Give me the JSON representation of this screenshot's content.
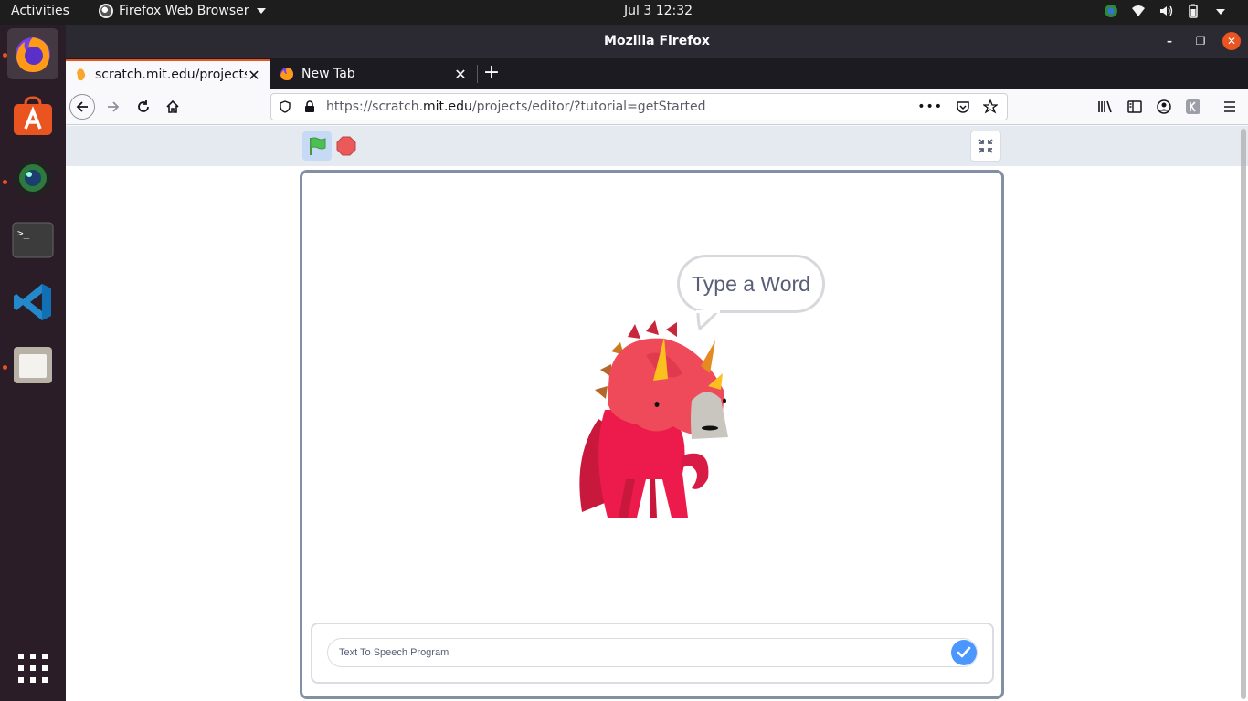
{
  "topbar": {
    "activities": "Activities",
    "app_menu": "Firefox Web Browser",
    "clock": "Jul 3  12:32"
  },
  "dock": {
    "items": [
      {
        "name": "Firefox",
        "icon": "firefox-icon"
      },
      {
        "name": "Ubuntu Software",
        "icon": "software-icon"
      },
      {
        "name": "Camera",
        "icon": "camera-icon"
      },
      {
        "name": "Terminal",
        "icon": "terminal-icon"
      },
      {
        "name": "Visual Studio Code",
        "icon": "vscode-icon"
      },
      {
        "name": "Files",
        "icon": "files-icon"
      },
      {
        "name": "Show Applications",
        "icon": "grid-icon"
      }
    ]
  },
  "window": {
    "title": "Mozilla Firefox"
  },
  "tabs": [
    {
      "label": "scratch.mit.edu/projects/",
      "active": true
    },
    {
      "label": "New Tab",
      "active": false
    }
  ],
  "urlbar": {
    "prefix": "https://scratch.",
    "domain": "mit.edu",
    "path": "/projects/editor/?tutorial=getStarted"
  },
  "stage": {
    "speech_bubble": "Type a Word",
    "ask_input_value": "Text To Speech Program"
  },
  "colors": {
    "accent": "#e95420",
    "scratch_blue": "#4c97ff",
    "stage_border": "#828fa4",
    "flag_green": "#4cbf56",
    "stop_red": "#ec5959"
  }
}
